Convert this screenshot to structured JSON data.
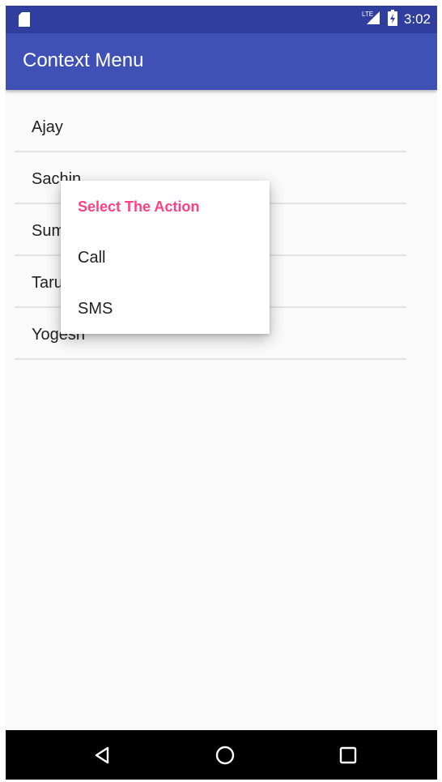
{
  "status_bar": {
    "time": "3:02",
    "network_label": "LTE",
    "icons": [
      "sd-card-icon",
      "signal-icon",
      "battery-icon"
    ]
  },
  "app_bar": {
    "title": "Context Menu",
    "color": "#3f51b5",
    "status_color": "#303f9f"
  },
  "list": {
    "items": [
      {
        "label": "Ajay"
      },
      {
        "label": "Sachin"
      },
      {
        "label": "Sum"
      },
      {
        "label": "Taru"
      },
      {
        "label": "Yogesh"
      }
    ]
  },
  "context_menu": {
    "title": "Select The Action",
    "title_color": "#ff4081",
    "items": [
      {
        "label": "Call"
      },
      {
        "label": "SMS"
      }
    ]
  },
  "nav_bar": {
    "icons": [
      "back-icon",
      "home-icon",
      "recents-icon"
    ]
  }
}
